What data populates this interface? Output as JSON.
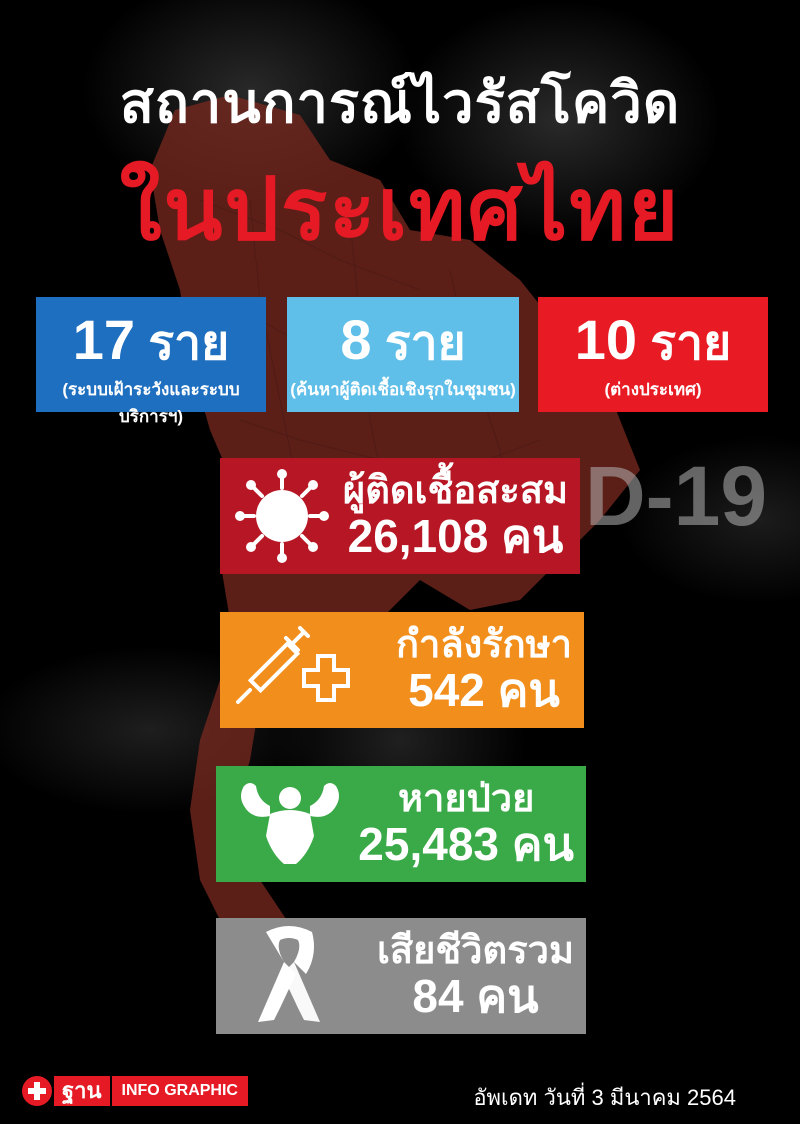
{
  "header": {
    "title_line1": "สถานการณ์ไวรัสโควิด",
    "title_line2": "ในประเทศไทย"
  },
  "tiles": [
    {
      "number": "17",
      "unit": "ราย",
      "note": "(ระบบเฝ้าระวังและระบบบริการฯ)",
      "color": "#1f6fc0"
    },
    {
      "number": "8",
      "unit": "ราย",
      "note": "(ค้นหาผู้ติดเชื้อเชิงรุกในชุมชน)",
      "color": "#5fbfe9"
    },
    {
      "number": "10",
      "unit": "ราย",
      "note": "(ต่างประเทศ)",
      "color": "#e81a23"
    }
  ],
  "cards": {
    "cumulative": {
      "label": "ผู้ติดเชื้อสะสม",
      "value": "26,108 คน",
      "icon": "virus-icon",
      "color": "#b71724"
    },
    "treating": {
      "label": "กำลังรักษา",
      "value": "542 คน",
      "icon": "syringe-icon",
      "color": "#f18e1c"
    },
    "recovered": {
      "label": "หายป่วย",
      "value": "25,483 คน",
      "icon": "muscle-icon",
      "color": "#3aa947"
    },
    "deaths": {
      "label": "เสียชีวิตรวม",
      "value": "84 คน",
      "icon": "ribbon-icon",
      "color": "#8c8c8c"
    }
  },
  "background": {
    "text": "D-19"
  },
  "footer": {
    "brand": "ฐาน",
    "tag": "INFO GRAPHIC",
    "update": "อัพเดท วันที่ 3 มีนาคม 2564"
  }
}
